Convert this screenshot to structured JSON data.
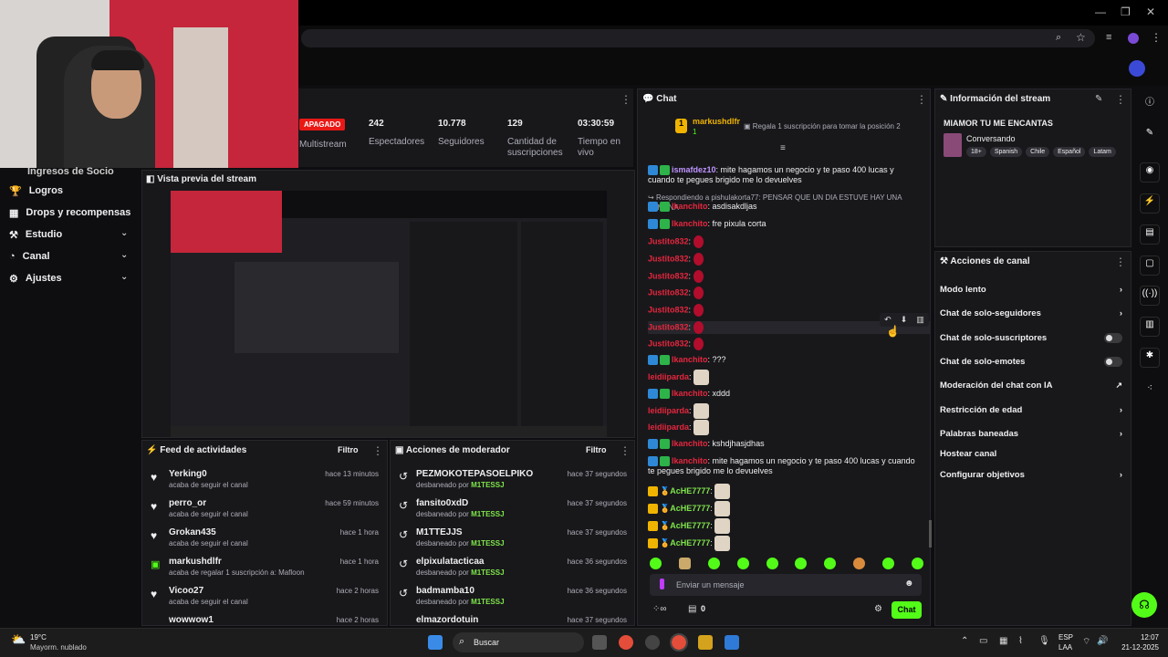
{
  "stream_status": {
    "state": "APAGADO",
    "title_tail": "Multistream"
  },
  "stats": [
    {
      "value": "242",
      "label": "Espectadores"
    },
    {
      "value": "10.778",
      "label": "Seguidores"
    },
    {
      "value": "129",
      "label": "Cantidad de suscripciones"
    },
    {
      "value": "03:30:59",
      "label": "Tiempo en vivo"
    }
  ],
  "sidebar": {
    "partial_item": "Ingresos de Socio",
    "items": [
      {
        "label": "Logros"
      },
      {
        "label": "Drops y recompensas"
      },
      {
        "label": "Estudio"
      },
      {
        "label": "Canal"
      },
      {
        "label": "Ajustes"
      }
    ]
  },
  "preview": {
    "title": "Vista previa del stream"
  },
  "feed": {
    "title": "Feed de actividades",
    "filter": "Filtro",
    "items": [
      {
        "name": "Yerking0",
        "desc": "acaba de seguir el canal",
        "time": "hace 13 minutos"
      },
      {
        "name": "perro_or",
        "desc": "acaba de seguir el canal",
        "time": "hace 59 minutos"
      },
      {
        "name": "Grokan435",
        "desc": "acaba de seguir el canal",
        "time": "hace 1 hora"
      },
      {
        "name": "markushdlfr",
        "desc": "acaba de regalar 1 suscripción a: Mafloon",
        "time": "hace 1 hora"
      },
      {
        "name": "Vicoo27",
        "desc": "acaba de seguir el canal",
        "time": "hace 2 horas"
      },
      {
        "name": "wowwow1",
        "desc": "",
        "time": "hace 2 horas"
      }
    ]
  },
  "mod_actions": {
    "title": "Acciones de moderador",
    "filter": "Filtro",
    "items": [
      {
        "name": "PEZMOKOTEPASOELPIKO",
        "desc": "desbaneado por",
        "by": "M1TESSJ",
        "time": "hace 37 segundos"
      },
      {
        "name": "fansito0xdD",
        "desc": "desbaneado por",
        "by": "M1TESSJ",
        "time": "hace 37 segundos"
      },
      {
        "name": "M1TTEJJS",
        "desc": "desbaneado por",
        "by": "M1TESSJ",
        "time": "hace 37 segundos"
      },
      {
        "name": "elpixulatacticaa",
        "desc": "desbaneado por",
        "by": "M1TESSJ",
        "time": "hace 36 segundos"
      },
      {
        "name": "badmamba10",
        "desc": "desbaneado por",
        "by": "M1TESSJ",
        "time": "hace 36 segundos"
      },
      {
        "name": "elmazordotuin",
        "desc": "",
        "by": "",
        "time": "hace 37 segundos"
      }
    ]
  },
  "chat": {
    "title": "Chat",
    "pinned_user": "markushdlfr",
    "pinned_count": "1",
    "gift_prompt": "Regala 1 suscripción para tomar la posición 2",
    "messages": [
      {
        "user": "ismafdez10",
        "color": "purple",
        "text": "mite hagamos un negocio y te paso 400 lucas y cuando te pegues brigido me lo devuelves"
      },
      {
        "reply": "Respondiendo a pishulakorta77: PENSAR QUE UN DIA ESTUVE HAY UNA SEMANA"
      },
      {
        "user": "lkanchito",
        "color": "red",
        "text": "asdisakdljas"
      },
      {
        "user": "lkanchito",
        "color": "red",
        "text": "fre pixula corta"
      },
      {
        "user": "Justito832",
        "color": "red",
        "emote": "heart"
      },
      {
        "user": "Justito832",
        "color": "red",
        "emote": "heart"
      },
      {
        "user": "Justito832",
        "color": "red",
        "emote": "heart"
      },
      {
        "user": "Justito832",
        "color": "red",
        "emote": "heart"
      },
      {
        "user": "Justito832",
        "color": "red",
        "emote": "heart"
      },
      {
        "user": "Justito832",
        "color": "red",
        "emote": "heart"
      },
      {
        "user": "Justito832",
        "color": "red",
        "emote": "heart"
      },
      {
        "user": "lkanchito",
        "color": "red",
        "text": "???"
      },
      {
        "user": "leidiiparda",
        "color": "red",
        "emote": "cat"
      },
      {
        "user": "lkanchito",
        "color": "red",
        "text": "xddd"
      },
      {
        "user": "leidiiparda",
        "color": "red",
        "emote": "cat"
      },
      {
        "user": "leidiiparda",
        "color": "red",
        "emote": "cat"
      },
      {
        "user": "lkanchito",
        "color": "red",
        "text": "kshdjhasjdhas"
      },
      {
        "user": "lkanchito",
        "color": "red",
        "text": "mite hagamos un negocio y te paso 400 lucas y cuando te pegues brigido me lo devuelves"
      },
      {
        "user": "AcHE7777",
        "color": "green",
        "emote": "cat"
      },
      {
        "user": "AcHE7777",
        "color": "green",
        "emote": "cat"
      },
      {
        "user": "AcHE7777",
        "color": "green",
        "emote": "cat"
      },
      {
        "user": "AcHE7777",
        "color": "green",
        "emote": "cat"
      }
    ],
    "input_placeholder": "Enviar un mensaje",
    "points": "0",
    "send_label": "Chat"
  },
  "stream_info": {
    "title": "Información del stream",
    "stream_title": "MIAMOR TU ME ENCANTAS",
    "category": "Conversando",
    "tags": [
      "18+",
      "Spanish",
      "Chile",
      "Español",
      "Latam"
    ]
  },
  "channel_actions": {
    "title": "Acciones de canal",
    "items": [
      {
        "label": "Modo lento",
        "kind": "arrow"
      },
      {
        "label": "Chat de solo-seguidores",
        "kind": "arrow"
      },
      {
        "label": "Chat de solo-suscriptores",
        "kind": "toggle"
      },
      {
        "label": "Chat de solo-emotes",
        "kind": "toggle"
      },
      {
        "label": "Moderación del chat con IA",
        "kind": "external"
      },
      {
        "label": "Restricción de edad",
        "kind": "arrow"
      },
      {
        "label": "Palabras baneadas",
        "kind": "arrow"
      },
      {
        "label": "Hostear canal",
        "kind": "none"
      },
      {
        "label": "Configurar objetivos",
        "kind": "arrow"
      }
    ]
  },
  "taskbar": {
    "weather_temp": "19°C",
    "weather_desc": "Mayorm. nublado",
    "search_label": "Buscar",
    "lang": "ESP",
    "lang_sub": "LAA",
    "time": "12:07",
    "date": "21-12-2025"
  },
  "colors": {
    "accent": "#53fc18",
    "bg": "#0e0e10",
    "panel": "#18181b",
    "live_red": "#e91916"
  }
}
